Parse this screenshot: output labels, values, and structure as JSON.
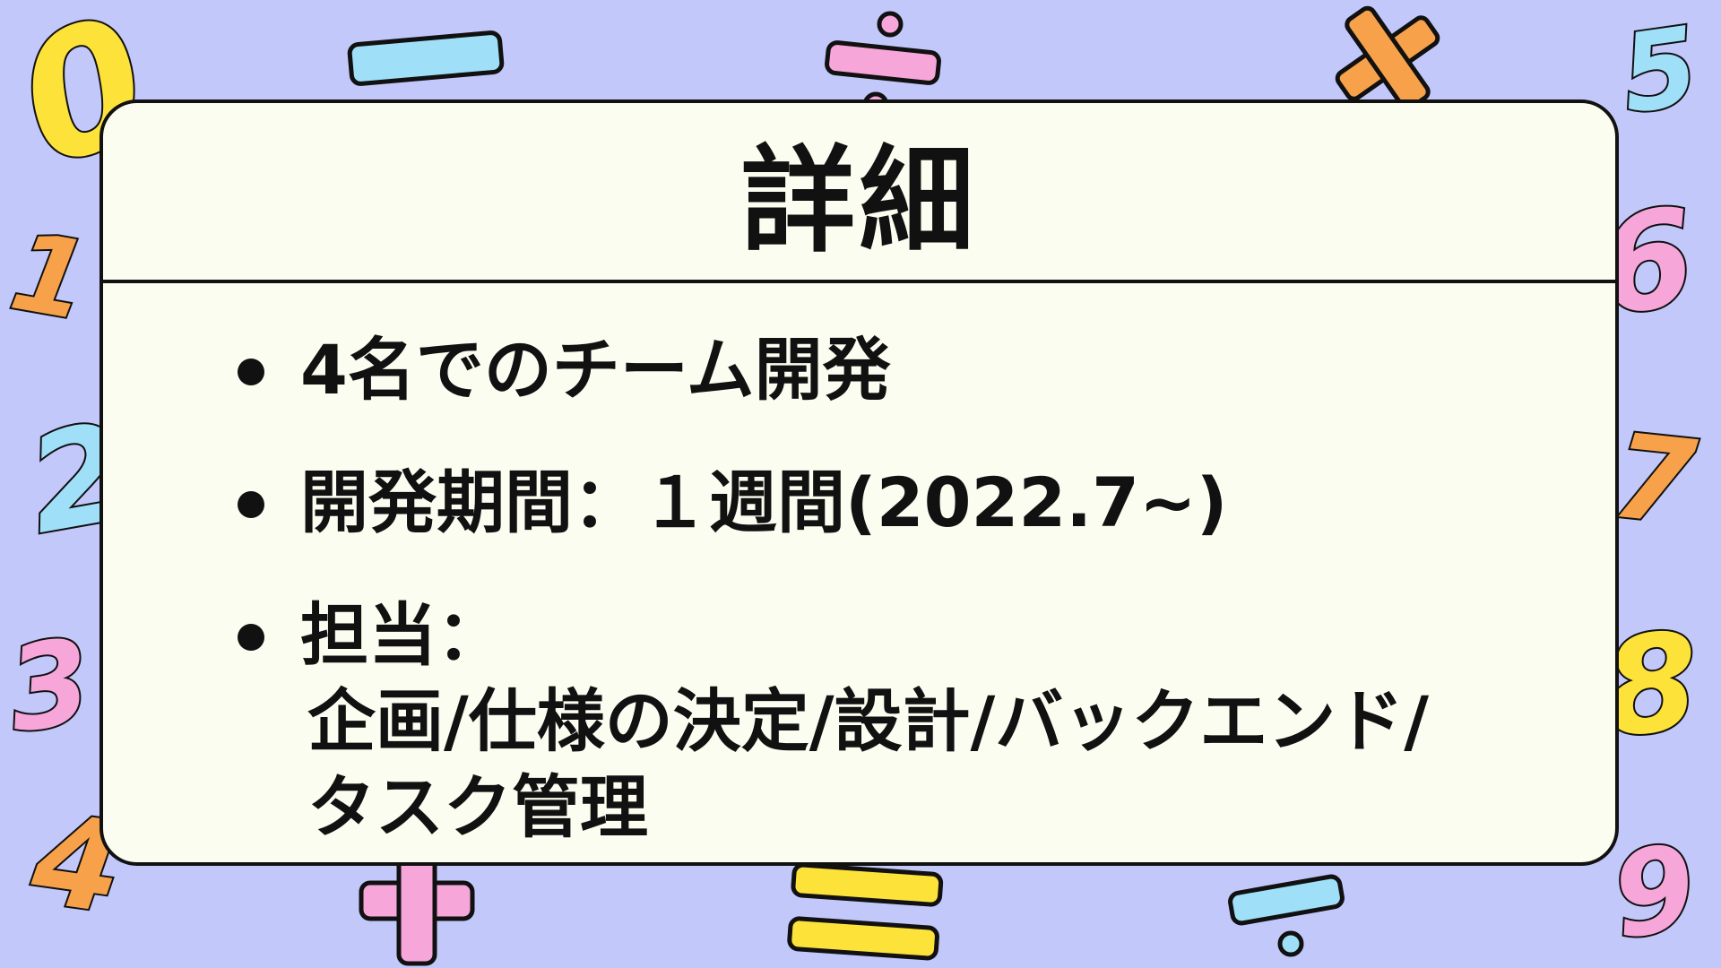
{
  "card": {
    "title": "詳細",
    "items": [
      {
        "text": "4名でのチーム開発"
      },
      {
        "text": "開発期間：１週間(2022.7~)"
      },
      {
        "text": "担当：",
        "lines": [
          "企画/仕様の決定/設計/バックエンド/",
          "タスク管理"
        ]
      }
    ]
  },
  "decorations": {
    "digits": [
      "0",
      "1",
      "2",
      "3",
      "4",
      "5",
      "6",
      "7",
      "8",
      "9"
    ],
    "colors": {
      "background": "#c3c8fb",
      "card": "#fbfdf0",
      "yellow": "#fde23a",
      "blue": "#9fdff7",
      "pink": "#f7a6da",
      "orange": "#f7a24a",
      "outline": "#111111"
    }
  }
}
